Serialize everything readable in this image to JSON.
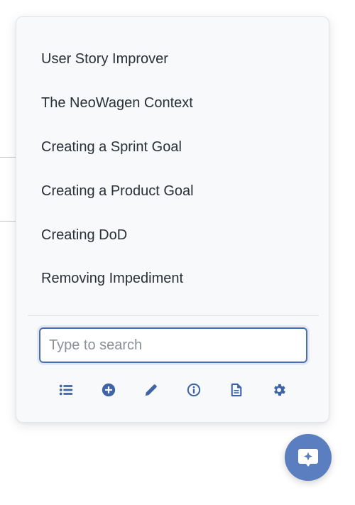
{
  "prompts": [
    {
      "label": "User Story Improver"
    },
    {
      "label": "The NeoWagen Context"
    },
    {
      "label": "Creating a Sprint Goal"
    },
    {
      "label": "Creating a Product Goal"
    },
    {
      "label": "Creating DoD"
    },
    {
      "label": "Removing Impediment"
    }
  ],
  "search": {
    "placeholder": "Type to search",
    "value": ""
  },
  "toolbar": {
    "icons": [
      "list-icon",
      "add-circle-icon",
      "pencil-icon",
      "info-icon",
      "document-icon",
      "gear-icon"
    ]
  },
  "fab": {
    "icon": "chat-sparkle-icon"
  },
  "colors": {
    "accent": "#3f64a6",
    "fab": "#5a7ec0",
    "panel_bg": "#f8f9fb",
    "text": "#2b2f36"
  }
}
